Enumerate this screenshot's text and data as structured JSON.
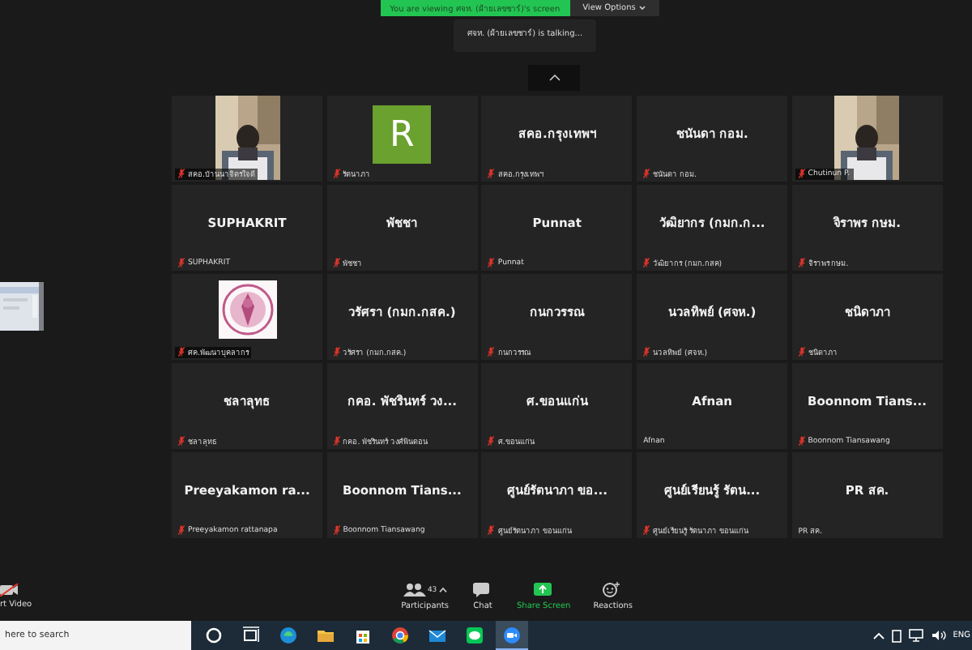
{
  "banner": {
    "text": "You are viewing ศจห. (ฝ้ายเลขชาร์)'s screen",
    "options": "View Options"
  },
  "talking": "ศจห. (ฝ้ายเลขชาร์) is talking...",
  "tiles": [
    {
      "kind": "picture",
      "label": "สคอ.บ้านนาจิตรใจดี",
      "muted": true
    },
    {
      "kind": "avatar",
      "letter": "R",
      "label": "รัตนาภา",
      "muted": true
    },
    {
      "kind": "name",
      "name": "สคอ.กรุงเทพฯ",
      "label": "สคอ.กรุงเทพฯ",
      "muted": true
    },
    {
      "kind": "name",
      "name": "ชนันดา กอม.",
      "label": "ชนันดา กอม.",
      "muted": true
    },
    {
      "kind": "picture",
      "label": "Chutinun P.",
      "muted": true
    },
    {
      "kind": "name",
      "name": "SUPHAKRIT",
      "label": "SUPHAKRIT",
      "muted": true
    },
    {
      "kind": "name",
      "name": "พัชชา",
      "label": "พัชชา",
      "muted": true
    },
    {
      "kind": "name",
      "name": "Punnat",
      "label": "Punnat",
      "muted": true
    },
    {
      "kind": "name",
      "name": "วัฒิยากร (กมก.ก...",
      "label": "วัฒิยากร (กมก.กสค)",
      "muted": true
    },
    {
      "kind": "name",
      "name": "จิราพร กษม.",
      "label": "จิราพร กษม.",
      "muted": true
    },
    {
      "kind": "emblem",
      "label": "ศค.พัฒนาบุคลากร",
      "muted": true
    },
    {
      "kind": "name",
      "name": "วรัศรา (กมก.กสค.)",
      "label": "วรัศรา (กมก.กสค.)",
      "muted": true
    },
    {
      "kind": "name",
      "name": "กนกวรรณ",
      "label": "กนกวรรณ",
      "muted": true
    },
    {
      "kind": "name",
      "name": "นวลทิพย์ (ศจห.)",
      "label": "นวลทิพย์ (ศจห.)",
      "muted": true
    },
    {
      "kind": "name",
      "name": "ชนิดาภา",
      "label": "ชนิดาภา",
      "muted": true
    },
    {
      "kind": "name",
      "name": "ชลาลุทธ",
      "label": "ชลาลุทธ",
      "muted": true
    },
    {
      "kind": "name",
      "name": "กคอ. พัชรินทร์ วง...",
      "label": "กคอ. พัชรินทร์ วงศ์พินดอน",
      "muted": true
    },
    {
      "kind": "name",
      "name": "ศ.ขอนแก่น",
      "label": "ศ.ขอนแก่น",
      "muted": true
    },
    {
      "kind": "name",
      "name": "Afnan",
      "label": "Afnan",
      "muted": false
    },
    {
      "kind": "name",
      "name": "Boonnom Tians...",
      "label": "Boonnom Tiansawang",
      "muted": true
    },
    {
      "kind": "name",
      "name": "Preeyakamon ra...",
      "label": "Preeyakamon rattanapa",
      "muted": true
    },
    {
      "kind": "name",
      "name": "Boonnom Tians...",
      "label": "Boonnom Tiansawang",
      "muted": true
    },
    {
      "kind": "name",
      "name": "ศูนย์รัตนาภา ขอ...",
      "label": "ศูนย์รัตนาภา ขอนแก่น",
      "muted": true
    },
    {
      "kind": "name",
      "name": "ศูนย์เรียนรู้ รัตน...",
      "label": "ศูนย์เรียนรู้ รัตนาภา ขอนแก่น",
      "muted": true
    },
    {
      "kind": "name",
      "name": "PR สค.",
      "label": "PR สค.",
      "muted": false
    }
  ],
  "video_button": {
    "label": "rt Video"
  },
  "toolbar": [
    {
      "kind": "participants",
      "label": "Participants",
      "count": "43"
    },
    {
      "kind": "chat",
      "label": "Chat"
    },
    {
      "kind": "share",
      "label": "Share Screen"
    },
    {
      "kind": "reactions",
      "label": "Reactions"
    }
  ],
  "taskbar": {
    "search": {
      "placeholder": "here to search"
    },
    "apps": [
      {
        "kind": "cortana",
        "active": false
      },
      {
        "kind": "taskview",
        "active": false
      },
      {
        "kind": "edge",
        "active": false
      },
      {
        "kind": "files",
        "active": false
      },
      {
        "kind": "store",
        "active": false
      },
      {
        "kind": "chrome",
        "active": false
      },
      {
        "kind": "mail",
        "active": false
      },
      {
        "kind": "line",
        "active": false
      },
      {
        "kind": "zoom",
        "active": true
      }
    ],
    "language": "ENG"
  }
}
